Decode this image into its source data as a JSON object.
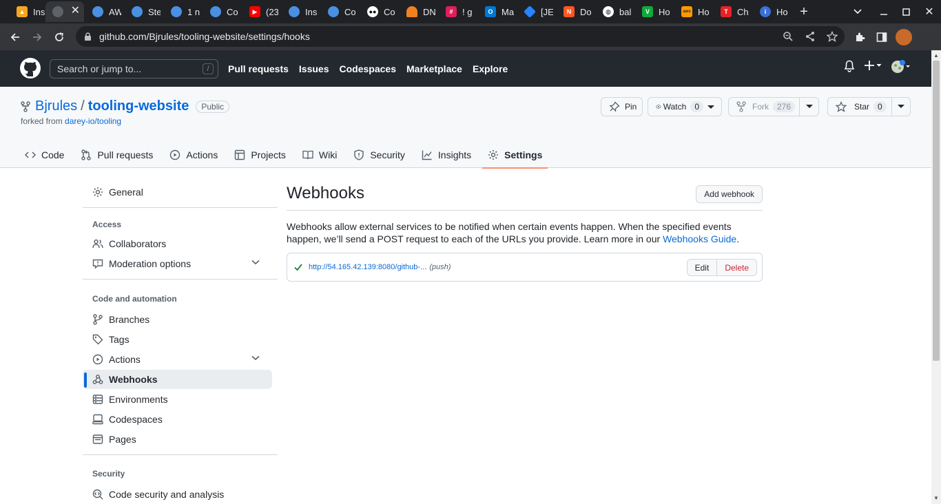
{
  "browser": {
    "tabs": [
      {
        "title": "Ins",
        "icon": "amazon-q-icon",
        "color": "#f5a623"
      },
      {
        "title": "",
        "icon": "github-icon",
        "color": "#5f6368",
        "active": true
      },
      {
        "title": "AW",
        "icon": "chrome-generic-icon",
        "color": "#4a90e2"
      },
      {
        "title": "Ste",
        "icon": "chrome-generic-icon",
        "color": "#4a90e2"
      },
      {
        "title": "1 n",
        "icon": "chrome-generic-icon",
        "color": "#4a90e2"
      },
      {
        "title": "Co",
        "icon": "chrome-generic-icon",
        "color": "#4a90e2"
      },
      {
        "title": "(23",
        "icon": "youtube-icon",
        "color": "#ff0000"
      },
      {
        "title": "Ins",
        "icon": "chrome-generic-icon",
        "color": "#4a90e2"
      },
      {
        "title": "Co",
        "icon": "chrome-generic-icon",
        "color": "#4a90e2"
      },
      {
        "title": "Co",
        "icon": "medium-icon",
        "color": "#ffffff"
      },
      {
        "title": "DN",
        "icon": "cloudflare-icon",
        "color": "#f38020"
      },
      {
        "title": "! g",
        "icon": "slack-icon",
        "color": "#e01e5a"
      },
      {
        "title": "Ma",
        "icon": "outlook-icon",
        "color": "#0078d4"
      },
      {
        "title": "[JE",
        "icon": "jira-icon",
        "color": "#2684ff"
      },
      {
        "title": "Do",
        "icon": "docs-icon",
        "color": "#ff5722"
      },
      {
        "title": "bal",
        "icon": "globe-icon",
        "color": "#ffffff"
      },
      {
        "title": "Ho",
        "icon": "vim-icon",
        "color": "#0eaa3b"
      },
      {
        "title": "Ho",
        "icon": "aws-icon",
        "color": "#ff9900"
      },
      {
        "title": "Ch",
        "icon": "tesla-icon",
        "color": "#e82127"
      },
      {
        "title": "Ho",
        "icon": "info-icon",
        "color": "#3b6fd8"
      }
    ],
    "url": "github.com/Bjrules/tooling-website/settings/hooks"
  },
  "gh_header": {
    "search_placeholder": "Search or jump to...",
    "slash_hint": "/",
    "nav": [
      "Pull requests",
      "Issues",
      "Codespaces",
      "Marketplace",
      "Explore"
    ]
  },
  "repo": {
    "owner": "Bjrules",
    "separator": "/",
    "name": "tooling-website",
    "visibility": "Public",
    "forked_prefix": "forked from",
    "forked_source": "darey-io/tooling",
    "pin_label": "Pin",
    "watch_label": "Watch",
    "watch_count": "0",
    "fork_label": "Fork",
    "fork_count": "276",
    "star_label": "Star",
    "star_count": "0",
    "tabs": [
      "Code",
      "Pull requests",
      "Actions",
      "Projects",
      "Wiki",
      "Security",
      "Insights",
      "Settings"
    ],
    "selected_tab": "Settings"
  },
  "sidebar": {
    "general": "General",
    "access_heading": "Access",
    "access_items": [
      "Collaborators",
      "Moderation options"
    ],
    "code_heading": "Code and automation",
    "code_items": [
      "Branches",
      "Tags",
      "Actions",
      "Webhooks",
      "Environments",
      "Codespaces",
      "Pages"
    ],
    "selected": "Webhooks",
    "security_heading": "Security",
    "security_items": [
      "Code security and analysis"
    ]
  },
  "main": {
    "title": "Webhooks",
    "add_button": "Add webhook",
    "description": "Webhooks allow external services to be notified when certain events happen. When the specified events happen, we’ll send a POST request to each of the URLs you provide. Learn more in our",
    "guide_link": "Webhooks Guide",
    "period": ".",
    "hook": {
      "url": "http://54.165.42.139:8080/github-...",
      "events": "(push)",
      "edit_label": "Edit",
      "delete_label": "Delete"
    }
  },
  "colors": {
    "accent": "#0969da",
    "selected_tab_underline": "#fd8c73",
    "danger": "#cf222e",
    "success": "#1a7f37",
    "header_bg": "#24292f"
  }
}
